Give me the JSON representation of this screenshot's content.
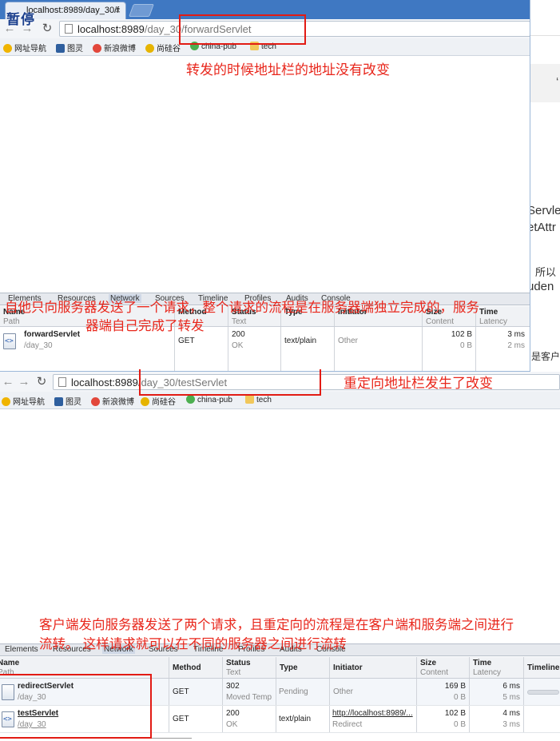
{
  "overlay_title": "暂停",
  "background_doc": {
    "fragments": [
      "Servle",
      "etAttr",
      "所以",
      "uden",
      "是客户"
    ]
  },
  "window1": {
    "tab_title": "localhost:8989/day_30/f",
    "tab_close": "×",
    "url_host": "localhost:8989",
    "url_path": "/day_30/forwardServlet",
    "bookmarks": [
      "网址导航",
      "图灵",
      "新浪微博",
      "尚硅谷",
      "china-pub",
      "tech"
    ],
    "devtools": {
      "tabs": [
        "Elements",
        "Resources",
        "Network",
        "Sources",
        "Timeline",
        "Profiles",
        "Audits",
        "Console"
      ],
      "columns": [
        {
          "h1": "Name",
          "h2": "Path"
        },
        {
          "h1": "Method",
          "h2": ""
        },
        {
          "h1": "Status",
          "h2": "Text"
        },
        {
          "h1": "Type",
          "h2": ""
        },
        {
          "h1": "Initiator",
          "h2": ""
        },
        {
          "h1": "Size",
          "h2": "Content"
        },
        {
          "h1": "Time",
          "h2": "Latency"
        }
      ],
      "rows": [
        {
          "name": "forwardServlet",
          "path": "/day_30",
          "method": "GET",
          "status": "200",
          "status_text": "OK",
          "type": "text/plain",
          "initiator": "Other",
          "initiator_sub": "",
          "size": "102 B",
          "content": "0 B",
          "time": "3 ms",
          "latency": "2 ms"
        }
      ]
    }
  },
  "window2": {
    "url_host": "localhost:8989",
    "url_path": "/day_30/testServlet",
    "bookmarks": [
      "网址导航",
      "图灵",
      "新浪微博",
      "尚硅谷",
      "china-pub",
      "tech"
    ],
    "devtools": {
      "tabs": [
        "Elements",
        "Resources",
        "Network",
        "Sources",
        "Timeline",
        "Profiles",
        "Audits",
        "Console"
      ],
      "columns": [
        {
          "h1": "Name",
          "h2": "Path"
        },
        {
          "h1": "Method",
          "h2": ""
        },
        {
          "h1": "Status",
          "h2": "Text"
        },
        {
          "h1": "Type",
          "h2": ""
        },
        {
          "h1": "Initiator",
          "h2": ""
        },
        {
          "h1": "Size",
          "h2": "Content"
        },
        {
          "h1": "Time",
          "h2": "Latency"
        },
        {
          "h1": "Timeline",
          "h2": ""
        }
      ],
      "rows": [
        {
          "name": "redirectServlet",
          "path": "/day_30",
          "method": "GET",
          "status": "302",
          "status_text": "Moved Temp",
          "type": "Pending",
          "initiator": "Other",
          "initiator_sub": "",
          "size": "169 B",
          "content": "0 B",
          "time": "6 ms",
          "latency": "5 ms"
        },
        {
          "name": "testServlet",
          "path": "/day_30",
          "method": "GET",
          "status": "200",
          "status_text": "OK",
          "type": "text/plain",
          "initiator": "http://localhost:8989/...",
          "initiator_sub": "Redirect",
          "size": "102 B",
          "content": "0 B",
          "time": "4 ms",
          "latency": "3 ms"
        }
      ]
    }
  },
  "annotations": {
    "forward_url": "转发的时候地址栏的地址没有改变",
    "forward_flow_line1": "自他只向服务器发送了一个请求，整个请求的流程是在服务器端独立完成的，服务",
    "forward_flow_line2": "器端自己完成了转发",
    "redirect_url": "重定向地址栏发生了改变",
    "redirect_flow_line1": "客户端发向服务器发送了两个请求，且重定向的流程是在客户端和服务端之间进行",
    "redirect_flow_line2": "流转。  这样请求就可以在不同的服务器之间进行流转"
  },
  "colors": {
    "annotation_red": "#e8261b",
    "tabstrip_blue": "#3f78c2"
  }
}
